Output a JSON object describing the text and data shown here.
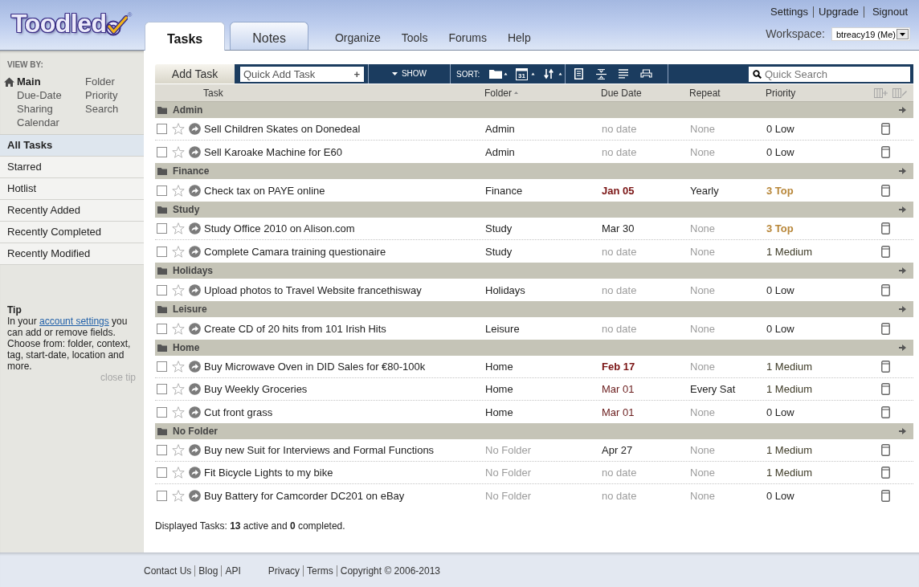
{
  "header": {
    "logo": {
      "text": "Toodled",
      "mark": "®"
    },
    "tabs": [
      {
        "label": "Tasks",
        "selected": true
      },
      {
        "label": "Notes",
        "selected": false
      }
    ],
    "nav_links": [
      "Organize",
      "Tools",
      "Forums",
      "Help"
    ],
    "account_links": [
      "Settings",
      "Upgrade",
      "Signout"
    ],
    "workspace": {
      "label": "Workspace:",
      "value": "btreacy19 (Me)"
    }
  },
  "sidebar": {
    "view_by_title": "VIEW BY:",
    "view_by": [
      {
        "label": "Main",
        "selected": true
      },
      {
        "label": "Due-Date",
        "selected": false
      },
      {
        "label": "Sharing",
        "selected": false
      },
      {
        "label": "Calendar",
        "selected": false
      },
      {
        "label": "Folder",
        "selected": false
      },
      {
        "label": "Priority",
        "selected": false
      },
      {
        "label": "Search",
        "selected": false
      }
    ],
    "lists": [
      {
        "label": "All Tasks",
        "selected": true
      },
      {
        "label": "Starred",
        "selected": false
      },
      {
        "label": "Hotlist",
        "selected": false
      },
      {
        "label": "Recently Added",
        "selected": false
      },
      {
        "label": "Recently Completed",
        "selected": false
      },
      {
        "label": "Recently Modified",
        "selected": false
      }
    ],
    "tip": {
      "title": "Tip",
      "text_before": "In your ",
      "link": "account settings",
      "text_after": " you can add or remove fields. Choose from: folder, context, tag, start-date, location and more.",
      "close": "close tip"
    }
  },
  "toolbar": {
    "add_task": "Add Task",
    "quick_add": {
      "placeholder": "Quick Add Task",
      "button": "+"
    },
    "show": "SHOW",
    "sort_label": "SORT:",
    "calendar_day": "31",
    "search": {
      "placeholder": "Quick Search"
    }
  },
  "table": {
    "columns": [
      {
        "label": "Task",
        "sorted": false
      },
      {
        "label": "Folder",
        "sorted": true
      },
      {
        "label": "Due Date",
        "sorted": false
      },
      {
        "label": "Repeat",
        "sorted": false
      },
      {
        "label": "Priority",
        "sorted": false
      }
    ],
    "groups": [
      {
        "name": "Admin",
        "tasks": [
          {
            "title": "Sell Children Skates on Donedeal",
            "checked": false,
            "starred": false,
            "folder": {
              "text": "Admin",
              "kind": "set"
            },
            "due": {
              "text": "no date",
              "kind": "none"
            },
            "repeat": {
              "text": "None",
              "kind": "none"
            },
            "priority": {
              "text": "0 Low",
              "kind": "low"
            }
          },
          {
            "title": "Sell Karoake Machine for E60",
            "checked": false,
            "starred": false,
            "folder": {
              "text": "Admin",
              "kind": "set"
            },
            "due": {
              "text": "no date",
              "kind": "none"
            },
            "repeat": {
              "text": "None",
              "kind": "none"
            },
            "priority": {
              "text": "0 Low",
              "kind": "low"
            }
          }
        ]
      },
      {
        "name": "Finance",
        "tasks": [
          {
            "title": "Check tax on PAYE online",
            "checked": false,
            "starred": false,
            "folder": {
              "text": "Finance",
              "kind": "set"
            },
            "due": {
              "text": "Jan 05",
              "kind": "overdue"
            },
            "repeat": {
              "text": "Yearly",
              "kind": "set"
            },
            "priority": {
              "text": "3 Top",
              "kind": "top"
            }
          }
        ]
      },
      {
        "name": "Study",
        "tasks": [
          {
            "title": "Study Office 2010 on Alison.com",
            "checked": false,
            "starred": false,
            "folder": {
              "text": "Study",
              "kind": "set"
            },
            "due": {
              "text": "Mar 30",
              "kind": "later"
            },
            "repeat": {
              "text": "None",
              "kind": "none"
            },
            "priority": {
              "text": "3 Top",
              "kind": "top"
            }
          },
          {
            "title": "Complete Camara training questionaire",
            "checked": false,
            "starred": false,
            "folder": {
              "text": "Study",
              "kind": "set"
            },
            "due": {
              "text": "no date",
              "kind": "none"
            },
            "repeat": {
              "text": "None",
              "kind": "none"
            },
            "priority": {
              "text": "1 Medium",
              "kind": "medium"
            }
          }
        ]
      },
      {
        "name": "Holidays",
        "tasks": [
          {
            "title": "Upload photos to Travel Website francethisway",
            "checked": false,
            "starred": false,
            "folder": {
              "text": "Holidays",
              "kind": "set"
            },
            "due": {
              "text": "no date",
              "kind": "none"
            },
            "repeat": {
              "text": "None",
              "kind": "none"
            },
            "priority": {
              "text": "0 Low",
              "kind": "low"
            }
          }
        ]
      },
      {
        "name": "Leisure",
        "tasks": [
          {
            "title": "Create CD of 20 hits from 101 Irish Hits",
            "checked": false,
            "starred": false,
            "folder": {
              "text": "Leisure",
              "kind": "set"
            },
            "due": {
              "text": "no date",
              "kind": "none"
            },
            "repeat": {
              "text": "None",
              "kind": "none"
            },
            "priority": {
              "text": "0 Low",
              "kind": "low"
            }
          }
        ]
      },
      {
        "name": "Home",
        "tasks": [
          {
            "title": "Buy Microwave Oven in DID Sales for €80-100k",
            "checked": false,
            "starred": false,
            "folder": {
              "text": "Home",
              "kind": "set"
            },
            "due": {
              "text": "Feb 17",
              "kind": "overdue"
            },
            "repeat": {
              "text": "None",
              "kind": "none"
            },
            "priority": {
              "text": "1 Medium",
              "kind": "medium"
            }
          },
          {
            "title": "Buy Weekly Groceries",
            "checked": false,
            "starred": false,
            "folder": {
              "text": "Home",
              "kind": "set"
            },
            "due": {
              "text": "Mar 01",
              "kind": "soon"
            },
            "repeat": {
              "text": "Every Sat",
              "kind": "set"
            },
            "priority": {
              "text": "1 Medium",
              "kind": "medium"
            }
          },
          {
            "title": "Cut front grass",
            "checked": false,
            "starred": false,
            "folder": {
              "text": "Home",
              "kind": "set"
            },
            "due": {
              "text": "Mar 01",
              "kind": "soon"
            },
            "repeat": {
              "text": "None",
              "kind": "none"
            },
            "priority": {
              "text": "0 Low",
              "kind": "low"
            }
          }
        ]
      },
      {
        "name": "No Folder",
        "tasks": [
          {
            "title": "Buy new Suit for Interviews and Formal Functions",
            "checked": false,
            "starred": false,
            "folder": {
              "text": "No Folder",
              "kind": "none"
            },
            "due": {
              "text": "Apr 27",
              "kind": "later"
            },
            "repeat": {
              "text": "None",
              "kind": "none"
            },
            "priority": {
              "text": "1 Medium",
              "kind": "medium"
            }
          },
          {
            "title": "Fit Bicycle Lights to my bike",
            "checked": false,
            "starred": false,
            "folder": {
              "text": "No Folder",
              "kind": "none"
            },
            "due": {
              "text": "no date",
              "kind": "none"
            },
            "repeat": {
              "text": "None",
              "kind": "none"
            },
            "priority": {
              "text": "1 Medium",
              "kind": "medium"
            }
          },
          {
            "title": "Buy Battery for Camcorder DC201 on eBay",
            "checked": false,
            "starred": false,
            "folder": {
              "text": "No Folder",
              "kind": "none"
            },
            "due": {
              "text": "no date",
              "kind": "none"
            },
            "repeat": {
              "text": "None",
              "kind": "none"
            },
            "priority": {
              "text": "0 Low",
              "kind": "low"
            }
          }
        ]
      }
    ]
  },
  "summary": "Displayed Tasks: **13** active and **0** completed.",
  "footer": {
    "left_links": [
      "Contact Us",
      "Blog",
      "API"
    ],
    "right_links": [
      "Privacy",
      "Terms"
    ],
    "copyright": "Copyright © 2006-2013"
  }
}
